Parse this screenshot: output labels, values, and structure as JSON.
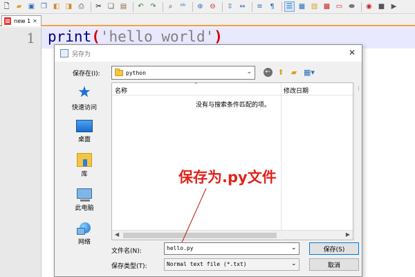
{
  "toolbar": {
    "buttons": [
      "new-file-icon",
      "open-file-icon",
      "save-icon",
      "save-all-icon",
      "close-icon",
      "close-all-icon",
      "print-icon",
      "cut-icon",
      "copy-icon",
      "paste-icon",
      "undo-icon",
      "redo-icon",
      "find-icon",
      "replace-icon",
      "zoom-in-icon",
      "zoom-out-icon",
      "sync-v-icon",
      "sync-h-icon",
      "wrap-icon",
      "all-chars-icon",
      "indent-guide-icon",
      "doc-map-icon",
      "function-list-icon",
      "folder-workspace-icon",
      "monitor-icon",
      "record-macro-icon",
      "stop-record-icon"
    ]
  },
  "tabs": [
    {
      "label": "new 1",
      "close": "✕"
    }
  ],
  "editor": {
    "line_number": "1",
    "code": {
      "keyword": "print",
      "open_paren": "(",
      "string": "'hello world'",
      "close_paren": ")"
    },
    "colors": {
      "keyword": "#000080",
      "string": "#808080",
      "brace_highlight": "#d00000",
      "current_line": "#e8e8ff"
    }
  },
  "dialog": {
    "title": "另存为",
    "close": "✕",
    "save_in_label": "保存在(I):",
    "save_in_value": "python",
    "places": [
      {
        "label": "快速访问",
        "icon": "quick-access-star-icon"
      },
      {
        "label": "桌面",
        "icon": "desktop-icon"
      },
      {
        "label": "库",
        "icon": "library-icon"
      },
      {
        "label": "此电脑",
        "icon": "this-pc-icon"
      },
      {
        "label": "网络",
        "icon": "network-icon"
      }
    ],
    "columns": {
      "name": "名称",
      "date": "修改日期"
    },
    "empty_message": "没有与搜索条件匹配的项。",
    "filename_label": "文件名(N):",
    "filename_value": "hello.py",
    "filetype_label": "保存类型(T):",
    "filetype_value": "Normal text file (*.txt)",
    "save_button": "保存(S)",
    "cancel_button": "取消"
  },
  "annotation": {
    "text": "保存为.py文件",
    "color": "#e0241a"
  }
}
